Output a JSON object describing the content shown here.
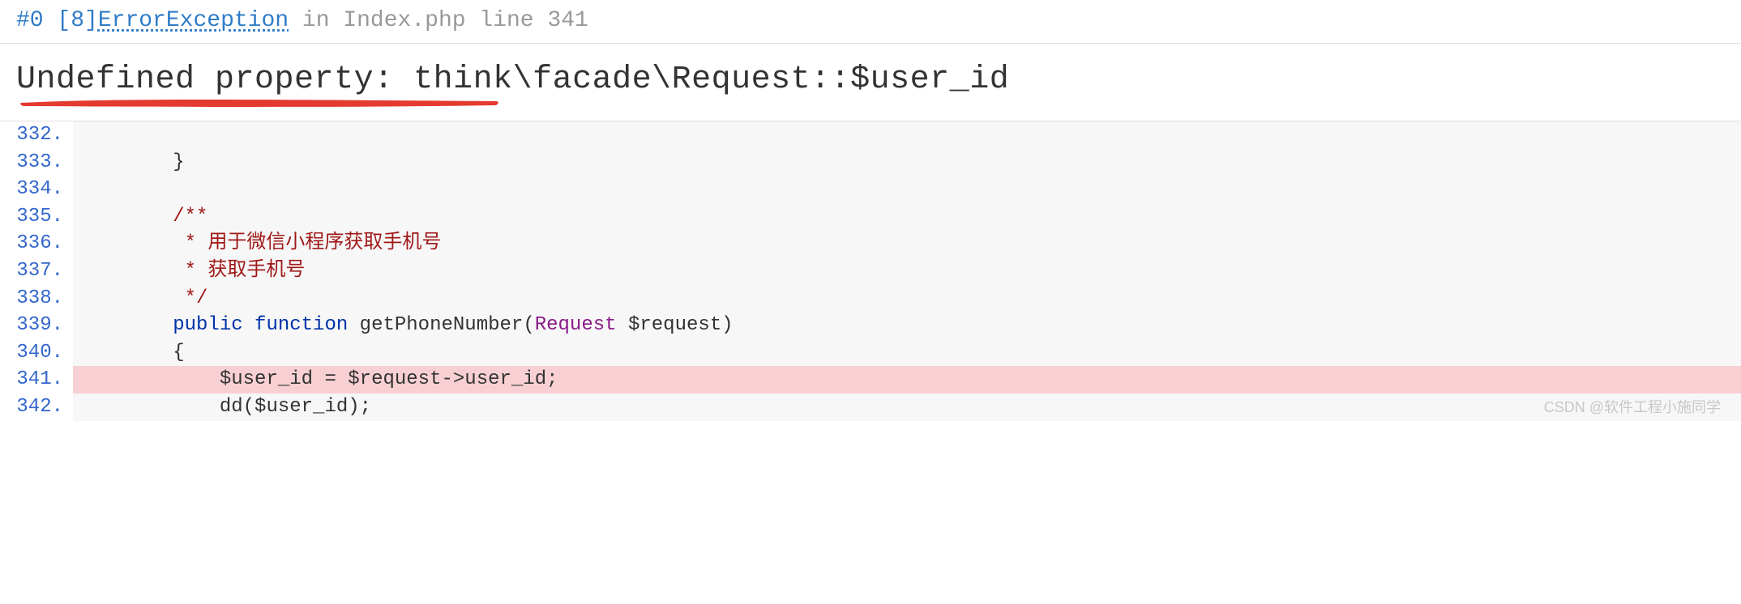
{
  "header": {
    "trace_index": "#0",
    "bracket_num": "[8]",
    "exception": "ErrorException",
    "in_keyword": "in",
    "file": "Index.php",
    "line_word": "line",
    "line_num": "341"
  },
  "error_message": "Undefined property: think\\facade\\Request::$user_id",
  "code": {
    "lines": [
      {
        "num": "332.",
        "html": "",
        "hl": false
      },
      {
        "num": "333.",
        "html": "        <span class='tok-punct'>}</span>",
        "hl": false
      },
      {
        "num": "334.",
        "html": "",
        "hl": false
      },
      {
        "num": "335.",
        "html": "        <span class='tok-comment'>/**</span>",
        "hl": false
      },
      {
        "num": "336.",
        "html": "         <span class='tok-comment'>* 用于微信小程序获取手机号</span>",
        "hl": false
      },
      {
        "num": "337.",
        "html": "         <span class='tok-comment'>* 获取手机号</span>",
        "hl": false
      },
      {
        "num": "338.",
        "html": "         <span class='tok-comment'>*/</span>",
        "hl": false
      },
      {
        "num": "339.",
        "html": "        <span class='tok-keyword'>public</span> <span class='tok-keyword'>function</span> <span class='tok-func'>getPhoneNumber</span><span class='tok-punct'>(</span><span class='tok-type'>Request</span> <span class='tok-var'>$request</span><span class='tok-punct'>)</span>",
        "hl": false
      },
      {
        "num": "340.",
        "html": "        <span class='tok-punct'>{</span>",
        "hl": false
      },
      {
        "num": "341.",
        "html": "            <span class='tok-var'>$user_id</span> <span class='tok-punct'>=</span> <span class='tok-var'>$request</span><span class='tok-punct'>-&gt;</span><span class='tok-var'>user_id</span><span class='tok-punct'>;</span>",
        "hl": true
      },
      {
        "num": "342.",
        "html": "            <span class='tok-func'>dd</span><span class='tok-punct'>(</span><span class='tok-var'>$user_id</span><span class='tok-punct'>);</span>",
        "hl": false
      }
    ]
  },
  "watermark": "CSDN @软件工程小施同学"
}
